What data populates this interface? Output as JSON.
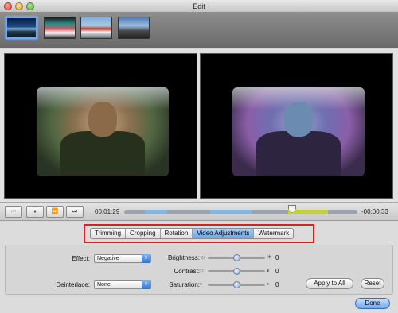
{
  "window": {
    "title": "Edit"
  },
  "thumbnails": [
    {
      "name": "clip-1",
      "selected": true
    },
    {
      "name": "clip-2",
      "selected": false
    },
    {
      "name": "clip-3",
      "selected": false
    },
    {
      "name": "clip-4",
      "selected": false
    }
  ],
  "player": {
    "prev_icon": "⏮",
    "pause_icon": "⏸",
    "fast_forward_icon": "⏩",
    "end_icon": "⏭",
    "current_time": "00:01:29",
    "remaining_time": "-00:00:33",
    "progress_fraction": 0.76
  },
  "tabs": [
    {
      "label": "Trimming",
      "active": false
    },
    {
      "label": "Cropping",
      "active": false
    },
    {
      "label": "Rotation",
      "active": false
    },
    {
      "label": "Video Adjustments",
      "active": true
    },
    {
      "label": "Watermark",
      "active": false
    }
  ],
  "adjustments": {
    "effect_label": "Effect:",
    "effect_value": "Negative",
    "deinterlace_label": "Deinterlace:",
    "deinterlace_value": "None",
    "brightness_label": "Brightness:",
    "brightness_value": "0",
    "contrast_label": "Contrast:",
    "contrast_value": "0",
    "saturation_label": "Saturation:",
    "saturation_value": "0",
    "apply_all_label": "Apply to All",
    "reset_label": "Reset"
  },
  "footer": {
    "done_label": "Done"
  },
  "colors": {
    "highlight_box": "#e01c1c",
    "active_tab": "#6aa6e6"
  }
}
